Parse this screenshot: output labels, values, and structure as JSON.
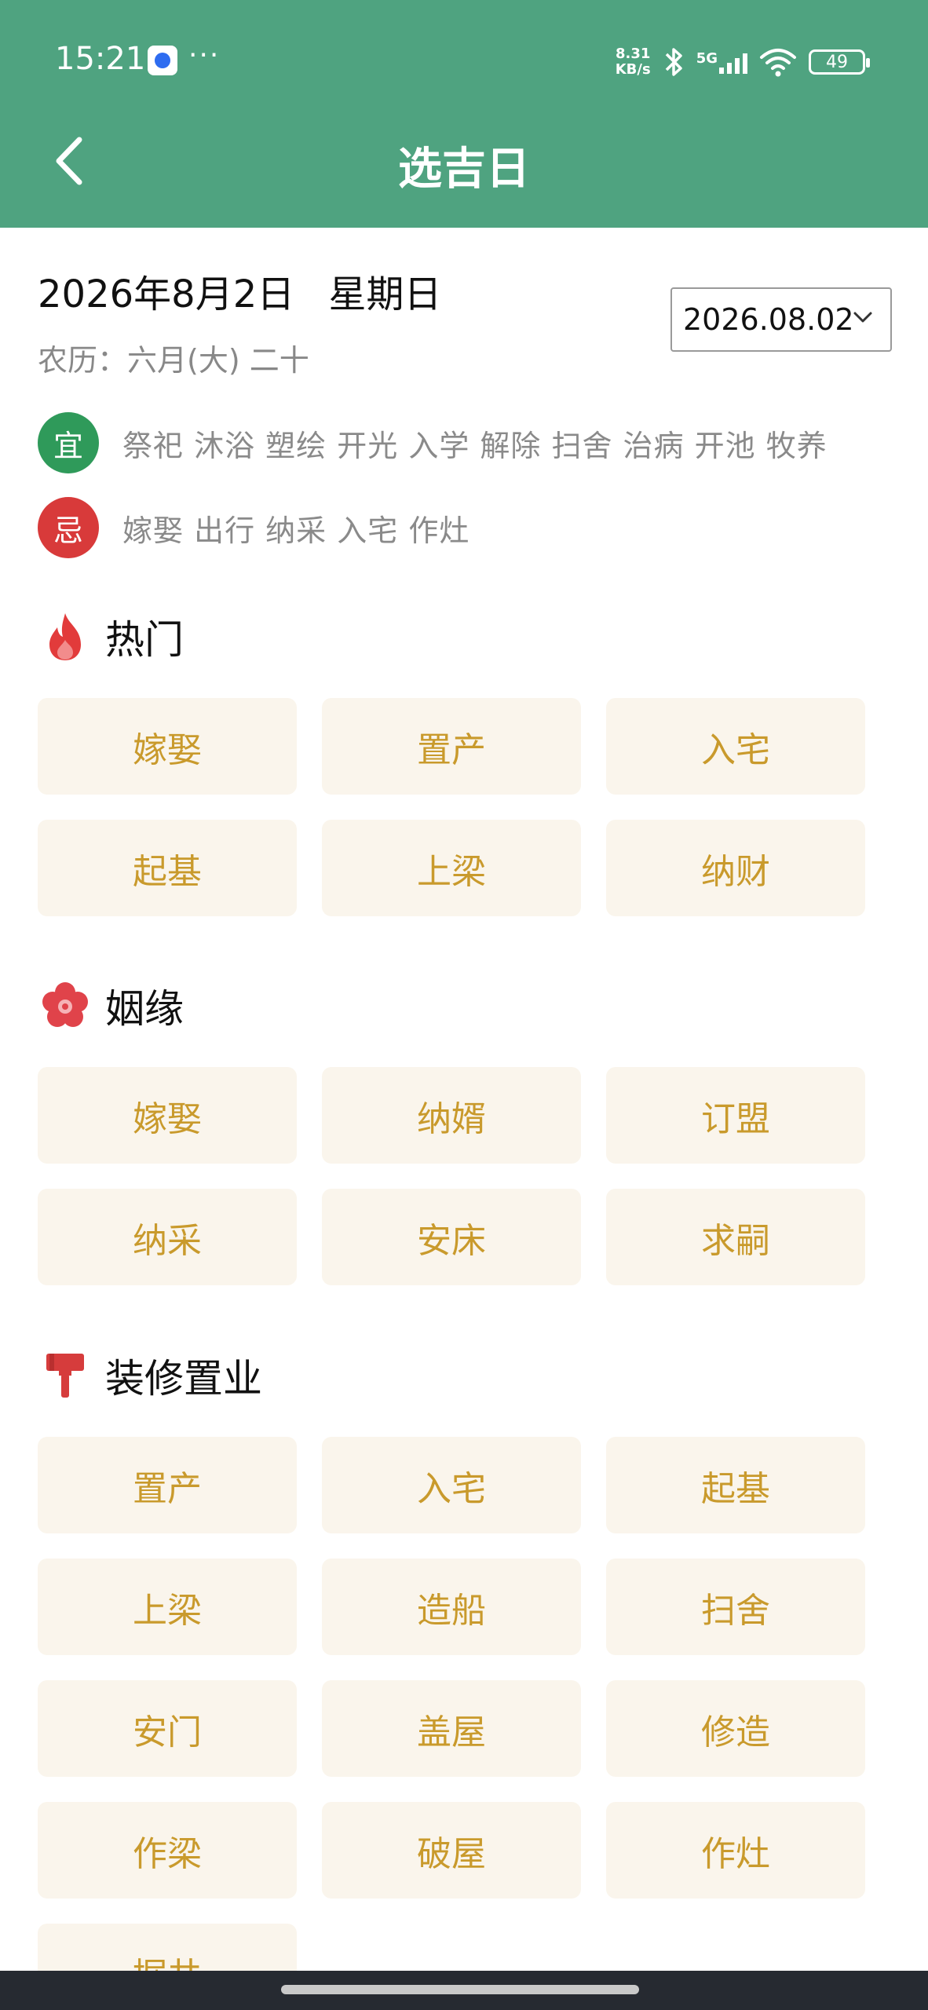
{
  "status_bar": {
    "time": "15:21",
    "more": "···",
    "speed_value": "8.31",
    "speed_unit": "KB/s",
    "network": "5G",
    "battery": "49"
  },
  "header": {
    "title": "选吉日",
    "back_icon": "back-chevron-icon"
  },
  "date": {
    "full": "2026年8月2日",
    "weekday": "星期日",
    "lunar": "农历：六月(大) 二十",
    "picker_value": "2026.08.02"
  },
  "auspicious": {
    "yi_label": "宜",
    "yi_items": "祭祀 沐浴 塑绘 开光 入学 解除 扫舍 治病 开池 牧养",
    "ji_label": "忌",
    "ji_items": "嫁娶 出行 纳采 入宅 作灶",
    "yi_color": "#2f9a5a",
    "ji_color": "#d83a3a"
  },
  "sections": [
    {
      "title": "热门",
      "icon": "fire-icon",
      "items": [
        "嫁娶",
        "置产",
        "入宅",
        "起基",
        "上梁",
        "纳财"
      ]
    },
    {
      "title": "姻缘",
      "icon": "flower-icon",
      "items": [
        "嫁娶",
        "纳婿",
        "订盟",
        "纳采",
        "安床",
        "求嗣"
      ]
    },
    {
      "title": "装修置业",
      "icon": "brush-icon",
      "items": [
        "置产",
        "入宅",
        "起基",
        "上梁",
        "造船",
        "扫舍",
        "安门",
        "盖屋",
        "修造",
        "作梁",
        "破屋",
        "作灶",
        "掘井"
      ]
    }
  ],
  "colors": {
    "header_bg": "#4fa380",
    "tile_bg": "#faf5ec",
    "tile_text": "#c99a2c"
  }
}
